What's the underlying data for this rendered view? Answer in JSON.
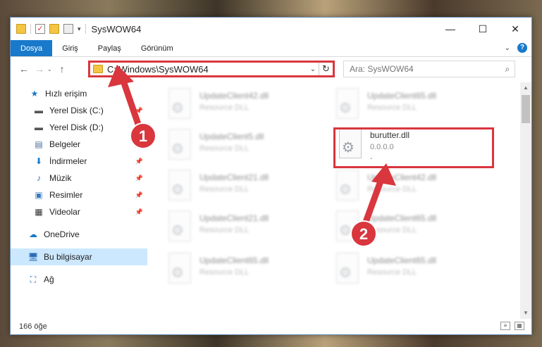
{
  "window": {
    "title": "SysWOW64"
  },
  "ribbon": {
    "tabs": [
      "Dosya",
      "Giriş",
      "Paylaş",
      "Görünüm"
    ]
  },
  "address": {
    "path": "C:\\Windows\\SysWOW64"
  },
  "search": {
    "placeholder": "Ara: SysWOW64"
  },
  "sidebar": {
    "items": [
      {
        "label": "Hızlı erişim",
        "icon": "star-icon",
        "pinned": false
      },
      {
        "label": "Yerel Disk (C:)",
        "icon": "disk-icon",
        "pinned": true
      },
      {
        "label": "Yerel Disk (D:)",
        "icon": "disk-icon",
        "pinned": true
      },
      {
        "label": "Belgeler",
        "icon": "documents-icon",
        "pinned": true
      },
      {
        "label": "İndirmeler",
        "icon": "download-icon",
        "pinned": true
      },
      {
        "label": "Müzik",
        "icon": "music-icon",
        "pinned": true
      },
      {
        "label": "Resimler",
        "icon": "pictures-icon",
        "pinned": true
      },
      {
        "label": "Videolar",
        "icon": "videos-icon",
        "pinned": true
      },
      {
        "label": "OneDrive",
        "icon": "cloud-icon",
        "pinned": false
      },
      {
        "label": "Bu bilgisayar",
        "icon": "computer-icon",
        "pinned": false,
        "selected": true
      },
      {
        "label": "Ağ",
        "icon": "network-icon",
        "pinned": false
      }
    ]
  },
  "files": [
    {
      "name": "UpdateClient42.dll",
      "sub": "Resource DLL"
    },
    {
      "name": "UpdateClient65.dll",
      "sub": "Resource DLL"
    },
    {
      "name": "UpdateClient5.dll",
      "sub": "Resource DLL"
    },
    {
      "name": "burutter.dll",
      "sub": "0.0.0.0",
      "extra": "-"
    },
    {
      "name": "UpdateClient21.dll",
      "sub": "Resource DLL"
    },
    {
      "name": "UpdateClient42.dll",
      "sub": "Resource DLL"
    },
    {
      "name": "UpdateClient21.dll",
      "sub": "Resource DLL"
    },
    {
      "name": "UpdateClient65.dll",
      "sub": "Resource DLL"
    },
    {
      "name": "UpdateClient65.dll",
      "sub": "Resource DLL"
    },
    {
      "name": "UpdateClient65.dll",
      "sub": "Resource DLL"
    }
  ],
  "status": {
    "count": "166 öğe"
  },
  "annotations": {
    "step1": "1",
    "step2": "2",
    "color": "#d9363e"
  }
}
